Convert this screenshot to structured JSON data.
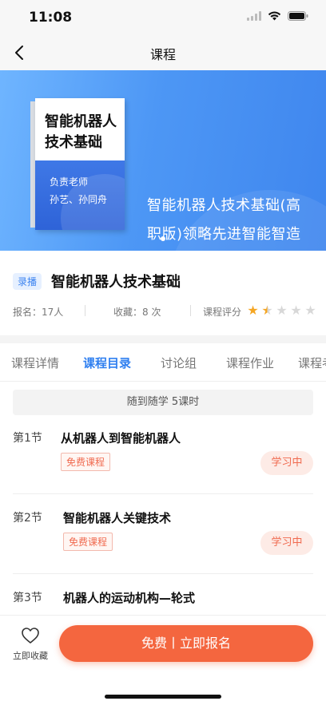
{
  "status_bar": {
    "time": "11:08"
  },
  "nav": {
    "title": "课程"
  },
  "banner": {
    "book_title_line1": "智能机器人",
    "book_title_line2": "技术基础",
    "teacher_label": "负责老师",
    "teacher_names": "孙艺、孙同舟",
    "slogan": "智能机器人技术基础(高职版)领略先进智能智造的魅力",
    "accent_color": "#4d97f5"
  },
  "course": {
    "tag": "录播",
    "title": "智能机器人技术基础",
    "enroll_text": "报名：17人",
    "favorite_text": "收藏：8 次",
    "rating_label": "课程评分",
    "rating": 1.5,
    "rating_max": 5
  },
  "tabs": [
    {
      "label": "课程详情"
    },
    {
      "label": "课程目录",
      "active": true
    },
    {
      "label": "讨论组"
    },
    {
      "label": "课程作业"
    },
    {
      "label": "课程考"
    }
  ],
  "lesson_list": {
    "header": "随到随学   5课时",
    "items": [
      {
        "num": "第1节",
        "title": "从机器人到智能机器人",
        "tag": "免费课程",
        "status": "学习中"
      },
      {
        "num": "第2节",
        "title": "智能机器人关键技术",
        "tag": "免费课程",
        "status": "学习中"
      },
      {
        "num": "第3节",
        "title": "机器人的运动机构—轮式",
        "tag": "",
        "status": ""
      }
    ]
  },
  "bottom": {
    "favorite_label": "立即收藏",
    "enroll_label": "免费丨立即报名",
    "enroll_color": "#f4663f"
  },
  "icons": [
    "back-chevron-icon",
    "signal-icon",
    "wifi-icon",
    "battery-icon",
    "star-icon",
    "heart-outline-icon"
  ]
}
